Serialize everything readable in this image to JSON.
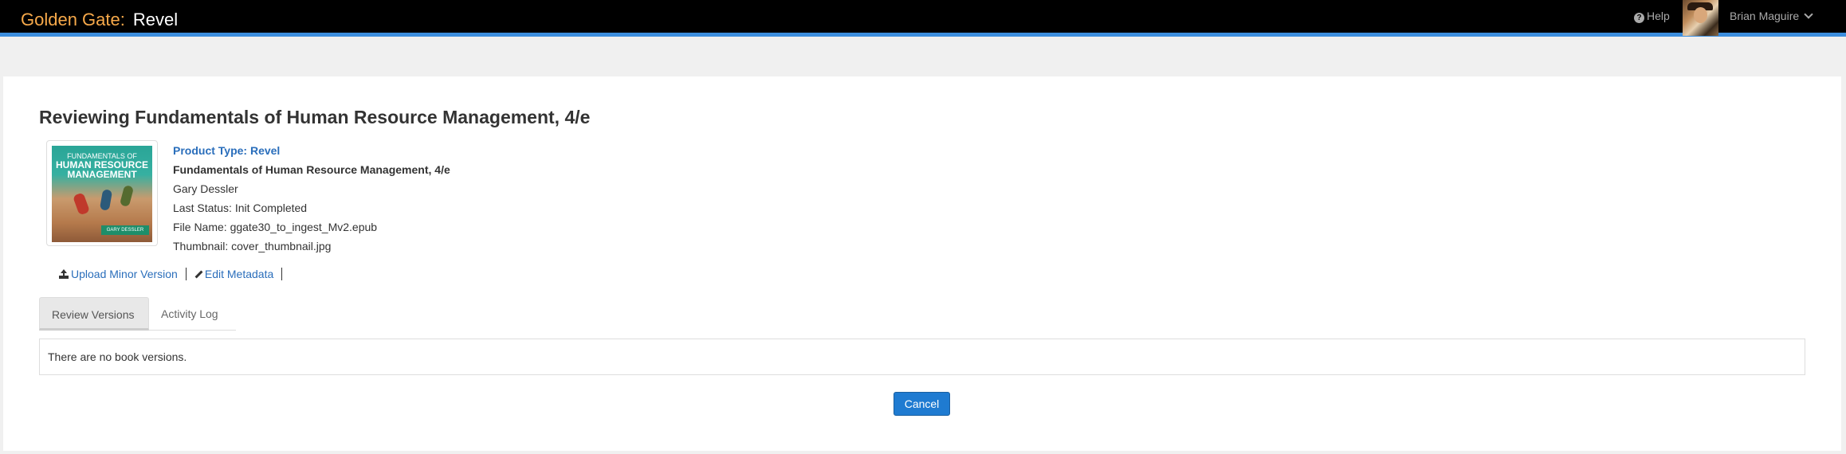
{
  "header": {
    "brand_primary": "Golden Gate:",
    "brand_secondary": "Revel",
    "help_label": "Help",
    "user_name": "Brian Maguire",
    "accent_color": "#3c8ede",
    "brand_color": "#f7a94a"
  },
  "page": {
    "title": "Reviewing Fundamentals of Human Resource Management, 4/e"
  },
  "book": {
    "cover_text_top": "FUNDAMENTALS OF",
    "cover_text_title": "HUMAN RESOURCE MANAGEMENT",
    "cover_author": "GARY DESSLER",
    "product_type": "Product Type: Revel",
    "title": "Fundamentals of Human Resource Management, 4/e",
    "author": "Gary Dessler",
    "last_status": "Last Status: Init Completed",
    "file_name": "File Name: ggate30_to_ingest_Mv2.epub",
    "thumbnail": "Thumbnail: cover_thumbnail.jpg"
  },
  "actions": {
    "upload_label": "Upload Minor Version",
    "edit_label": "Edit Metadata"
  },
  "tabs": [
    {
      "label": "Review Versions",
      "active": true
    },
    {
      "label": "Activity Log",
      "active": false
    }
  ],
  "content": {
    "empty_message": "There are no book versions."
  },
  "buttons": {
    "cancel_label": "Cancel"
  }
}
